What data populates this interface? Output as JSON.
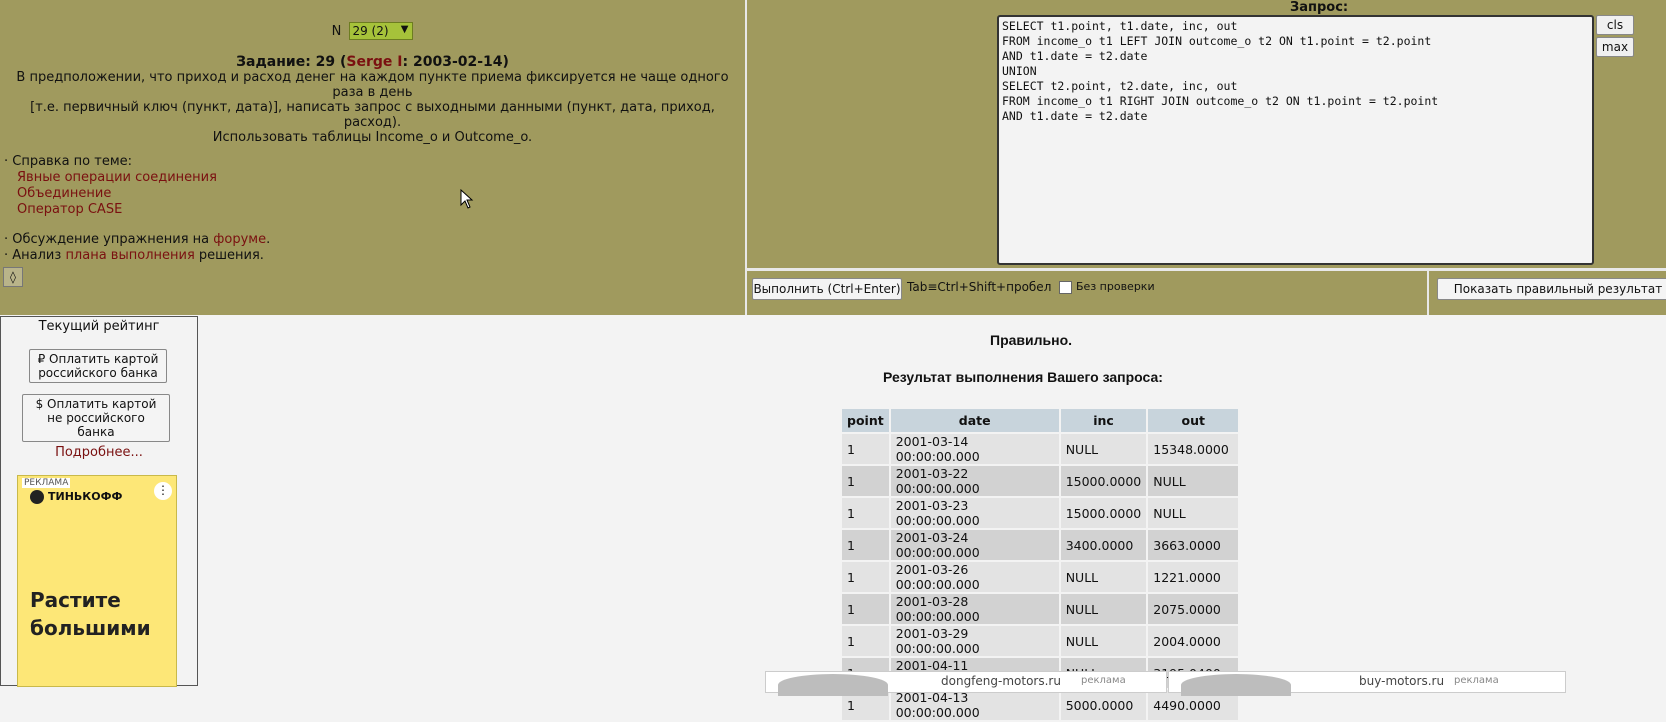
{
  "task": {
    "n_label": "N",
    "n_selected": "29 (2)",
    "title_prefix": "Задание: 29 (",
    "author": "Serge I",
    "title_suffix": ": 2003-02-14)",
    "text_1": "В предположении, что приход и расход денег на каждом пункте приема фиксируется не чаще одного раза в день",
    "text_2": "[т.е. первичный ключ (пункт, дата)], написать запрос с выходными данными (пункт, дата, приход, расход).",
    "text_3": "Использовать таблицы Income_o и Outcome_o."
  },
  "help": {
    "heading": "· Справка по теме:",
    "links": [
      "Явные операции соединения",
      "Объединение",
      "Оператор CASE"
    ]
  },
  "forum": {
    "prefix": "· Обсуждение упражнения на ",
    "link": "форуме",
    "suffix": "."
  },
  "plan": {
    "prefix": "· Анализ ",
    "link": "плана выполнения",
    "suffix": " решения."
  },
  "query": {
    "label": "Запрос:",
    "text": "SELECT t1.point, t1.date, inc, out\nFROM income_o t1 LEFT JOIN outcome_o t2 ON t1.point = t2.point\nAND t1.date = t2.date\nUNION\nSELECT t2.point, t2.date, inc, out\nFROM income_o t1 RIGHT JOIN outcome_o t2 ON t1.point = t2.point\nAND t1.date = t2.date",
    "cls_label": "cls",
    "max_label": "max"
  },
  "run_bar": {
    "run_label": "Выполнить (Ctrl+Enter)",
    "tab_hint": "Tab≡Ctrl+Shift+пробел",
    "no_check_label": "Без  проверки",
    "show_correct_label": "Показать правильный результат"
  },
  "sidebar": {
    "rating_title": "Текущий рейтинг",
    "pay_ru_line1": "₽ Оплатить картой",
    "pay_ru_line2": "российского банка",
    "pay_foreign_line1": "$ Оплатить картой",
    "pay_foreign_line2": "не российского банка",
    "more": "Подробнее...",
    "ad_tag": "РЕКЛАМА",
    "ad_brand": "ТИНЬКОФФ",
    "ad_headline_1": "Растите",
    "ad_headline_2": "большими"
  },
  "result": {
    "status": "Правильно.",
    "heading": "Результат выполнения Вашего запроса:",
    "columns": [
      "point",
      "date",
      "inc",
      "out"
    ],
    "rows": [
      [
        "1",
        "2001-03-14 00:00:00.000",
        "NULL",
        "15348.0000"
      ],
      [
        "1",
        "2001-03-22 00:00:00.000",
        "15000.0000",
        "NULL"
      ],
      [
        "1",
        "2001-03-23 00:00:00.000",
        "15000.0000",
        "NULL"
      ],
      [
        "1",
        "2001-03-24 00:00:00.000",
        "3400.0000",
        "3663.0000"
      ],
      [
        "1",
        "2001-03-26 00:00:00.000",
        "NULL",
        "1221.0000"
      ],
      [
        "1",
        "2001-03-28 00:00:00.000",
        "NULL",
        "2075.0000"
      ],
      [
        "1",
        "2001-03-29 00:00:00.000",
        "NULL",
        "2004.0000"
      ],
      [
        "1",
        "2001-04-11 00:00:00.000",
        "NULL",
        "3195.0400"
      ],
      [
        "1",
        "2001-04-13 00:00:00.000",
        "5000.0000",
        "4490.0000"
      ]
    ]
  },
  "bottom_ads": {
    "left_site": "dongfeng-motors.ru",
    "right_site": "buy-motors.ru",
    "tag": "реклама"
  }
}
